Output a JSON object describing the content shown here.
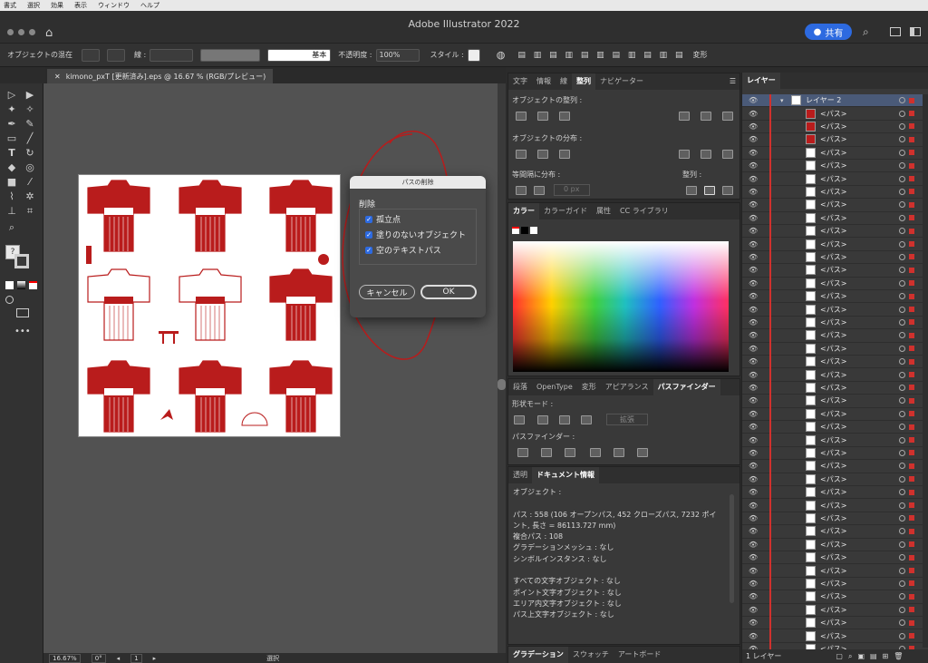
{
  "menubar": {
    "items": [
      "書式",
      "選択",
      "効果",
      "表示",
      "ウィンドウ",
      "ヘルプ"
    ]
  },
  "app": {
    "title": "Adobe Illustrator 2022",
    "share_label": "共有"
  },
  "control": {
    "selection_label": "オブジェクトの混在",
    "stroke_label": "線 :",
    "stroke_style": "基本",
    "opacity_label": "不透明度 :",
    "opacity_value": "100%",
    "style_label": "スタイル :",
    "transform_label": "変形"
  },
  "document": {
    "tab_title": "kimono_pxT [更新済み].eps @ 16.67 % (RGB/プレビュー)"
  },
  "status": {
    "zoom": "16.67%",
    "rotation": "0°",
    "artboard_num": "1",
    "mode": "選択"
  },
  "dialog": {
    "title": "パスの削除",
    "group_label": "削除",
    "options": [
      "孤立点",
      "塗りのないオブジェクト",
      "空のテキストパス"
    ],
    "cancel": "キャンセル",
    "ok": "OK"
  },
  "panels": {
    "align_tabs": [
      "文字",
      "情報",
      "線",
      "整列",
      "ナビゲーター"
    ],
    "align_active": "整列",
    "align_objects": "オブジェクトの整列 :",
    "distribute_objects": "オブジェクトの分布 :",
    "distribute_spacing": "等間隔に分布 :",
    "align_to": "整列 :",
    "spacing_value": "0 px",
    "color_tabs": [
      "カラー",
      "カラーガイド",
      "属性",
      "CC ライブラリ"
    ],
    "color_active": "カラー",
    "path_tabs": [
      "段落",
      "OpenType",
      "変形",
      "アピアランス",
      "パスファインダー"
    ],
    "path_active": "パスファインダー",
    "shape_modes": "形状モード :",
    "expand": "拡張",
    "pathfinders": "パスファインダー :",
    "doc_tabs": [
      "透明",
      "ドキュメント情報"
    ],
    "doc_active": "ドキュメント情報",
    "doc_info": [
      "オブジェクト :",
      "",
      "パス : 558 (106 オープンパス, 452 クローズパス, 7232 ポイ",
      "ント, 長さ = 86113.727 mm)",
      "複合パス : 108",
      "グラデーションメッシュ : なし",
      "シンボルインスタンス : なし",
      "",
      "すべての文字オブジェクト : なし",
      "ポイント文字オブジェクト : なし",
      "エリア内文字オブジェクト : なし",
      "パス上文字オブジェクト : なし"
    ],
    "bottom_tabs": [
      "グラデーション",
      "スウォッチ",
      "アートボード"
    ],
    "bottom_active": "グラデーション"
  },
  "layers": {
    "tab": "レイヤー",
    "layer_name": "レイヤー 2",
    "item_label": "<パス>",
    "footer": "1 レイヤー",
    "count": 42
  },
  "colors": {
    "accent": "#2d6ae0",
    "kimono_red": "#b91c1c",
    "layer_color": "#d0312d"
  }
}
